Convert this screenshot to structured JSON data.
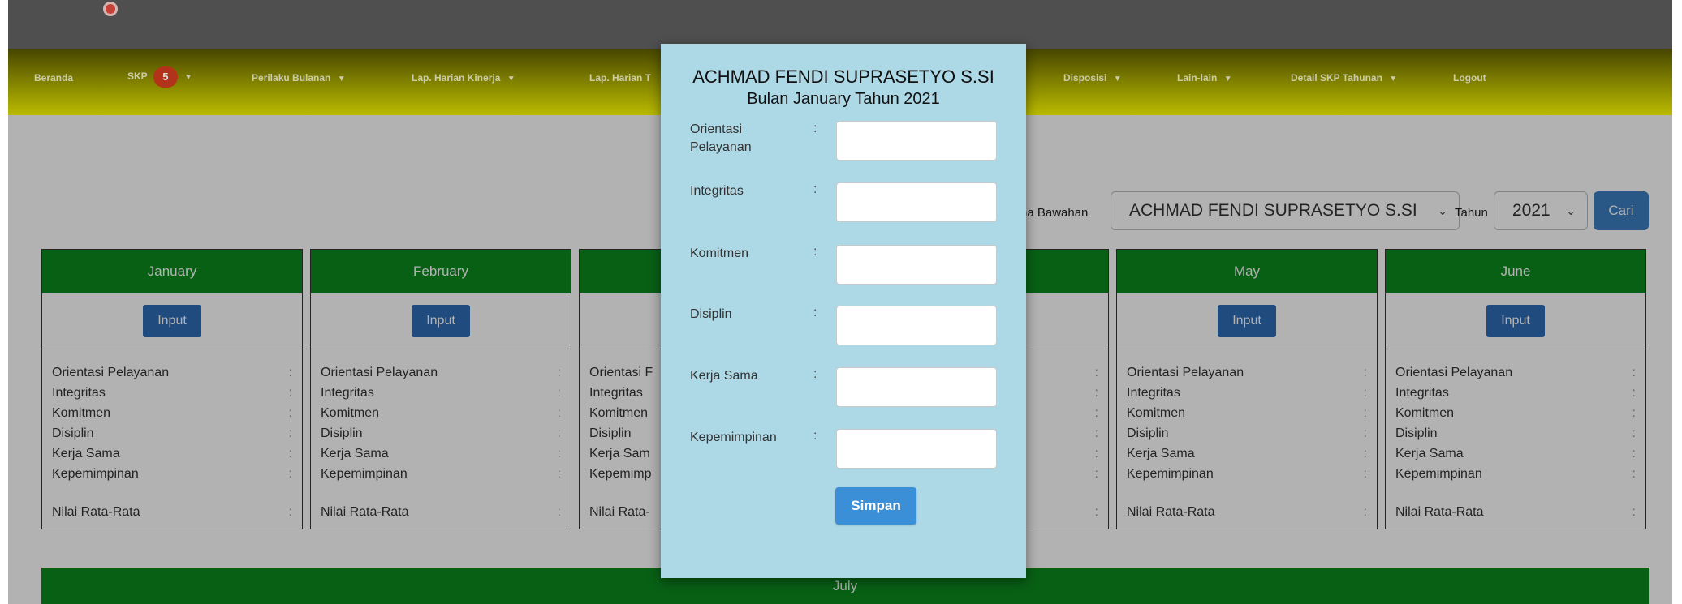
{
  "nav": {
    "items": [
      {
        "label": "Beranda",
        "caret": false
      },
      {
        "label": "SKP",
        "badge": "5",
        "caret": true
      },
      {
        "label": "Perilaku Bulanan",
        "caret": true
      },
      {
        "label": "Lap. Harian Kinerja",
        "caret": true
      },
      {
        "label": "Lap. Harian T",
        "caret": false
      },
      {
        "label": "Disposisi",
        "caret": true
      },
      {
        "label": "Lain-lain",
        "caret": true
      },
      {
        "label": "Detail SKP Tahunan",
        "caret": true
      },
      {
        "label": "Logout",
        "caret": false
      }
    ],
    "caret_glyph": "▼"
  },
  "filter": {
    "bawahan_label": "na Bawahan",
    "bawahan_value": "ACHMAD FENDI SUPRASETYO S.SI",
    "tahun_label": "Tahun",
    "tahun_value": "2021",
    "chevron_glyph": "⌄",
    "search_button": "Cari"
  },
  "months": [
    {
      "name": "January",
      "input_label": "Input"
    },
    {
      "name": "February",
      "input_label": "Input"
    },
    {
      "name": "",
      "input_label": ""
    },
    {
      "name": "",
      "input_label": ""
    },
    {
      "name": "May",
      "input_label": "Input"
    },
    {
      "name": "June",
      "input_label": "Input"
    }
  ],
  "metric_labels": {
    "orientasi": "Orientasi Pelayanan",
    "integritas": "Integritas",
    "komitmen": "Komitmen",
    "disiplin": "Disiplin",
    "kerja_sama": "Kerja Sama",
    "kepemimpinan": "Kepemimpinan",
    "nilai": "Nilai Rata-Rata",
    "colon": ":"
  },
  "partial_metrics": {
    "orientasi": "Orientasi F",
    "integritas": "Integritas",
    "komitmen": "Komitmen",
    "disiplin": "Disiplin",
    "kerja_sama": "Kerja Sam",
    "kepemimpinan": "Kepemimp",
    "nilai": "Nilai Rata-"
  },
  "july": {
    "name": "July"
  },
  "modal": {
    "title_name": "ACHMAD FENDI SUPRASETYO S.SI",
    "title_period": "Bulan January Tahun 2021",
    "fields": [
      {
        "label": "Orientasi Pelayanan",
        "value": ""
      },
      {
        "label": "Integritas",
        "value": ""
      },
      {
        "label": "Komitmen",
        "value": ""
      },
      {
        "label": "Disiplin",
        "value": ""
      },
      {
        "label": "Kerja Sama",
        "value": ""
      },
      {
        "label": "Kepemimpinan",
        "value": ""
      }
    ],
    "colon": ":",
    "save_button": "Simpan"
  }
}
